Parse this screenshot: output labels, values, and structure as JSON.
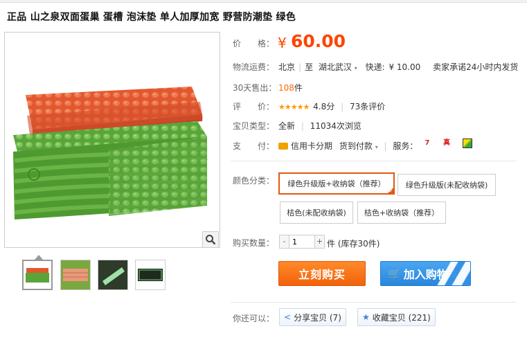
{
  "product": {
    "title": "正品 山之泉双面蛋巢 蛋槽 泡沫垫 单人加厚加宽 野营防潮垫 绿色"
  },
  "price": {
    "label": "价　　格：",
    "currency": "¥",
    "value": "60.00"
  },
  "shipping": {
    "label": "物流运费：",
    "from": "北京",
    "to_prefix": "至",
    "to": "湖北武汉",
    "express_label": "快递:",
    "express_price": "¥ 10.00",
    "promise": "卖家承诺24小时内发货"
  },
  "sales": {
    "label": "30天售出：",
    "count": "108",
    "unit": "件"
  },
  "rating": {
    "label": "评　　价：",
    "stars": "★★★★★",
    "score": "4.8分",
    "reviews": "73条评价"
  },
  "type": {
    "label": "宝贝类型：",
    "condition": "全新",
    "views": "11034次浏览"
  },
  "payment": {
    "label": "支　　付：",
    "credit": "信用卡分期",
    "cod": "货到付款",
    "services_label": "服务：",
    "services": [
      "7",
      "真"
    ]
  },
  "color": {
    "label": "颜色分类：",
    "options": [
      "绿色升级版+收纳袋（推荐）",
      "绿色升级版(未配收纳袋)",
      "桔色(未配收纳袋)",
      "桔色+收纳袋（推荐）"
    ],
    "selected_index": 0
  },
  "quantity": {
    "label": "购买数量：",
    "value": "1",
    "unit_stock": "件 (库存30件)"
  },
  "actions": {
    "buy_now": "立刻购买",
    "add_to_cart": "加入购物车"
  },
  "share": {
    "label": "你还可以：",
    "share_btn": "分享宝贝 (7)",
    "fav_btn": "收藏宝贝 (221)"
  },
  "colors": {
    "price": "#ff4400",
    "buy": "#f2620a",
    "cart": "#2a86db",
    "selected_border": "#e05a10"
  }
}
